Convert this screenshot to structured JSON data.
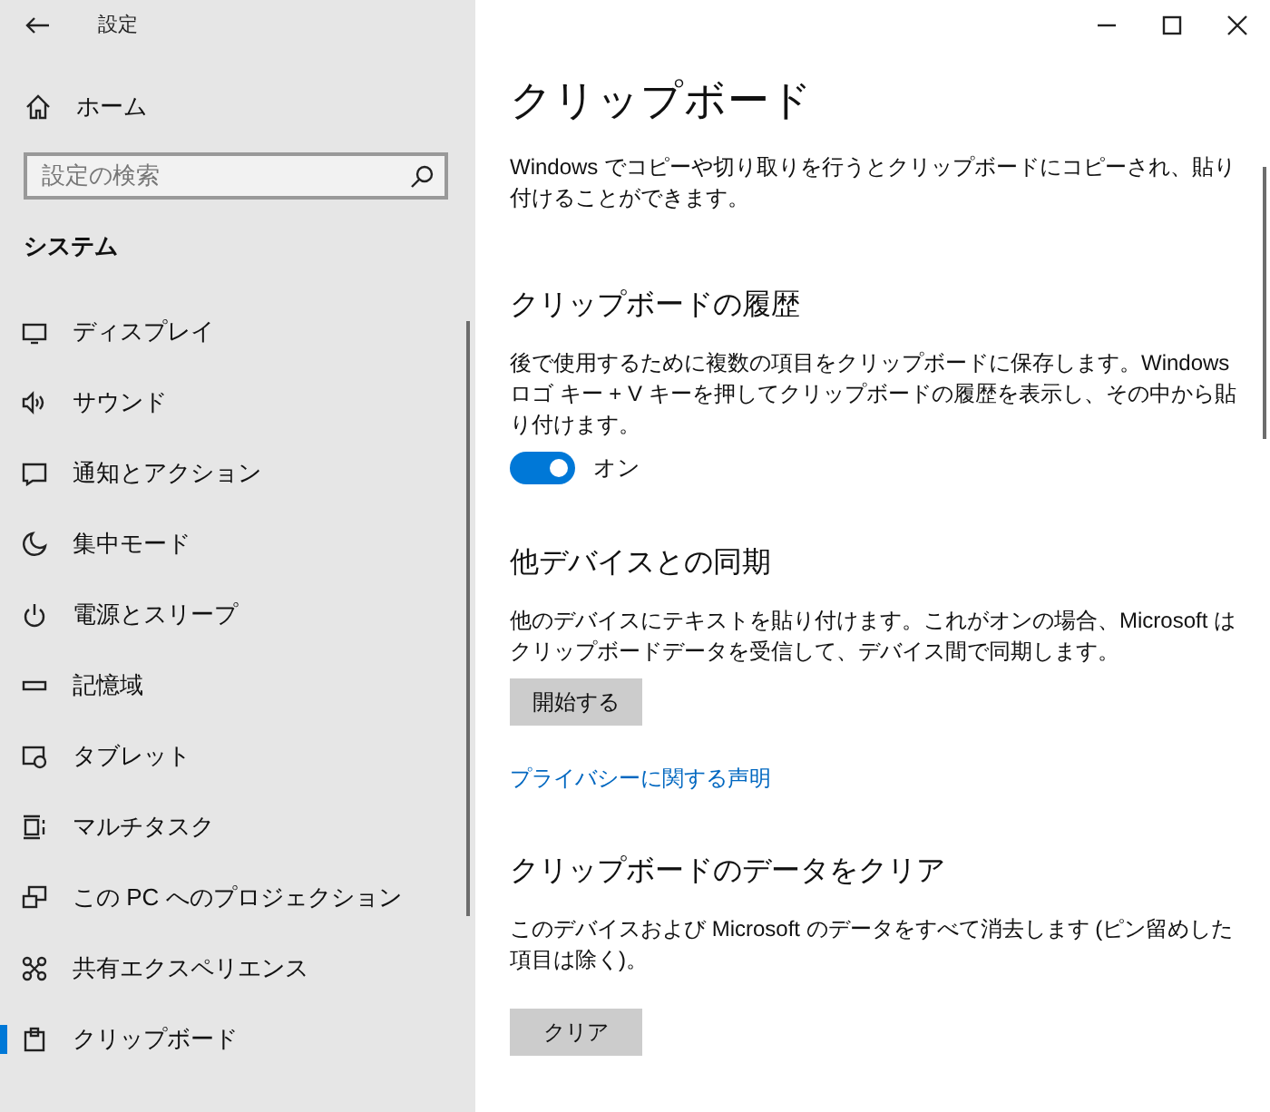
{
  "window": {
    "title": "設定"
  },
  "sidebar": {
    "home": "ホーム",
    "search": {
      "placeholder": "設定の検索"
    },
    "section": "システム",
    "items": [
      {
        "label": "ディスプレイ",
        "selected": false
      },
      {
        "label": "サウンド",
        "selected": false
      },
      {
        "label": "通知とアクション",
        "selected": false
      },
      {
        "label": "集中モード",
        "selected": false
      },
      {
        "label": "電源とスリープ",
        "selected": false
      },
      {
        "label": "記憶域",
        "selected": false
      },
      {
        "label": "タブレット",
        "selected": false
      },
      {
        "label": "マルチタスク",
        "selected": false
      },
      {
        "label": "この PC へのプロジェクション",
        "selected": false
      },
      {
        "label": "共有エクスペリエンス",
        "selected": false
      },
      {
        "label": "クリップボード",
        "selected": true
      }
    ]
  },
  "content": {
    "title": "クリップボード",
    "intro": "Windows でコピーや切り取りを行うとクリップボードにコピーされ、貼り付けることができます。",
    "sections": [
      {
        "heading": "クリップボードの履歴",
        "text": "後で使用するために複数の項目をクリップボードに保存します。Windows ロゴ キー + V キーを押してクリップボードの履歴を表示し、その中から貼り付けます。",
        "toggle": {
          "on": true,
          "label": "オン"
        }
      },
      {
        "heading": "他デバイスとの同期",
        "text": "他のデバイスにテキストを貼り付けます。これがオンの場合、Microsoft はクリップボードデータを受信して、デバイス間で同期します。",
        "button": "開始する",
        "link": "プライバシーに関する声明"
      },
      {
        "heading": "クリップボードのデータをクリア",
        "text": "このデバイスおよび Microsoft のデータをすべて消去します (ピン留めした項目は除く)。",
        "button": "クリア"
      }
    ]
  }
}
